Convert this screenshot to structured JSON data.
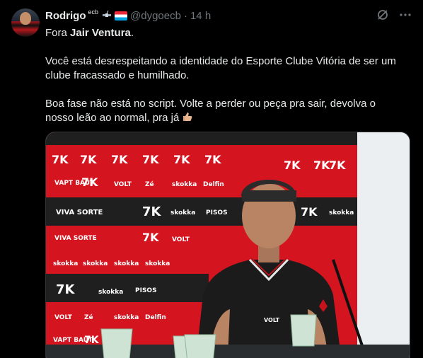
{
  "author": {
    "name": "Rodrigo",
    "name_suffix": "ecb",
    "handle": "@dygoecb",
    "time": "14 h",
    "avatar": "avatar-photo",
    "emoji_icons": [
      "satellite-icon",
      "flag-luxembourg-icon"
    ]
  },
  "tweet": {
    "line1_prefix": "Fora ",
    "line1_mention": "Jair Ventura",
    "line1_suffix": ".",
    "paragraph2": "Você está desrespeitando a identidade do Esporte Clube Vitória de ser um clube fracassado e humilhado.",
    "paragraph3": "Boa fase não está no script. Volte a perder ou peça pra sair, devolva o nosso leão ao normal, pra já",
    "trailing_emoji": "thumbs-up-icon"
  },
  "actions": {
    "grok_icon": "grok-icon",
    "more_icon": "more-icon"
  },
  "media": {
    "description_icon": "photo",
    "backdrop_color": "#d41520"
  },
  "colors": {
    "background": "#000000",
    "text": "#e7e9ea",
    "muted": "#71767b"
  }
}
